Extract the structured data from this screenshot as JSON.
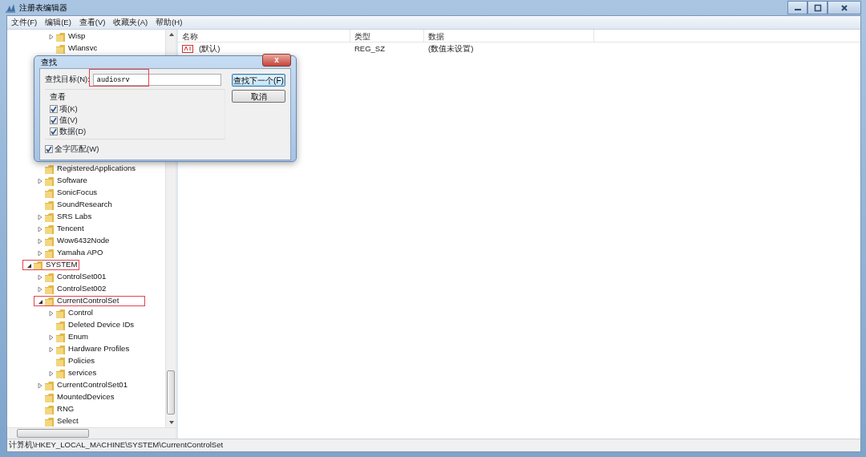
{
  "window": {
    "title": "注册表编辑器"
  },
  "menu": [
    "文件(F)",
    "编辑(E)",
    "查看(V)",
    "收藏夹(A)",
    "帮助(H)"
  ],
  "tree": [
    {
      "children": [
        {
          "children": [
            {
              "label": "Wisp",
              "expandable": true,
              "expanded": false,
              "highlighted": false
            },
            {
              "label": "Wlansvc",
              "expandable": false,
              "highlighted": false
            }
          ]
        },
        {
          "label": "RegisteredApplications",
          "expandable": false,
          "highlighted": false
        },
        {
          "label": "Software",
          "expandable": true,
          "expanded": false,
          "highlighted": false
        },
        {
          "label": "SonicFocus",
          "expandable": false,
          "highlighted": false
        },
        {
          "label": "SoundResearch",
          "expandable": false,
          "highlighted": false
        },
        {
          "label": "SRS Labs",
          "expandable": true,
          "expanded": false,
          "highlighted": false
        },
        {
          "label": "Tencent",
          "expandable": true,
          "expanded": false,
          "highlighted": false
        },
        {
          "label": "Wow6432Node",
          "expandable": true,
          "expanded": false,
          "highlighted": false
        },
        {
          "label": "Yamaha APO",
          "expandable": true,
          "expanded": false,
          "highlighted": false
        }
      ]
    },
    {
      "label": "SYSTEM",
      "expandable": true,
      "expanded": true,
      "highlighted": true,
      "children": [
        {
          "label": "ControlSet001",
          "expandable": true,
          "expanded": false,
          "highlighted": false
        },
        {
          "label": "ControlSet002",
          "expandable": true,
          "expanded": false,
          "highlighted": false
        },
        {
          "label": "CurrentControlSet",
          "expandable": true,
          "expanded": true,
          "highlighted": true,
          "children": [
            {
              "label": "Control",
              "expandable": true,
              "expanded": false,
              "highlighted": false
            },
            {
              "label": "Deleted Device IDs",
              "expandable": false,
              "highlighted": false
            },
            {
              "label": "Enum",
              "expandable": true,
              "expanded": false,
              "highlighted": false
            },
            {
              "label": "Hardware Profiles",
              "expandable": true,
              "expanded": false,
              "highlighted": false
            },
            {
              "label": "Policies",
              "expandable": false,
              "highlighted": false
            },
            {
              "label": "services",
              "expandable": true,
              "expanded": false,
              "highlighted": false
            }
          ]
        },
        {
          "label": "CurrentControlSet01",
          "expandable": true,
          "expanded": false,
          "highlighted": false
        },
        {
          "label": "MountedDevices",
          "expandable": false,
          "highlighted": false
        },
        {
          "label": "RNG",
          "expandable": false,
          "highlighted": false
        },
        {
          "label": "Select",
          "expandable": false,
          "highlighted": false
        }
      ]
    }
  ],
  "values": {
    "columns": [
      "名称",
      "类型",
      "数据"
    ],
    "rows": [
      {
        "name": "(默认)",
        "type": "REG_SZ",
        "data": "(数值未设置)"
      }
    ]
  },
  "find_dialog": {
    "title": "查找",
    "close": "x",
    "target_label": "查找目标(N):",
    "target_value": "audiosrv",
    "target_highlighted": true,
    "look_in_label": "查看",
    "options": [
      {
        "label": "项(K)",
        "checked": true
      },
      {
        "label": "值(V)",
        "checked": true
      },
      {
        "label": "数据(D)",
        "checked": true
      }
    ],
    "whole_match": {
      "label": "全字匹配(W)",
      "checked": true
    },
    "buttons": [
      {
        "label": "查找下一个(F)",
        "default": true
      },
      {
        "label": "取消",
        "default": false
      }
    ]
  },
  "status_bar": "计算机\\HKEY_LOCAL_MACHINE\\SYSTEM\\CurrentControlSet"
}
